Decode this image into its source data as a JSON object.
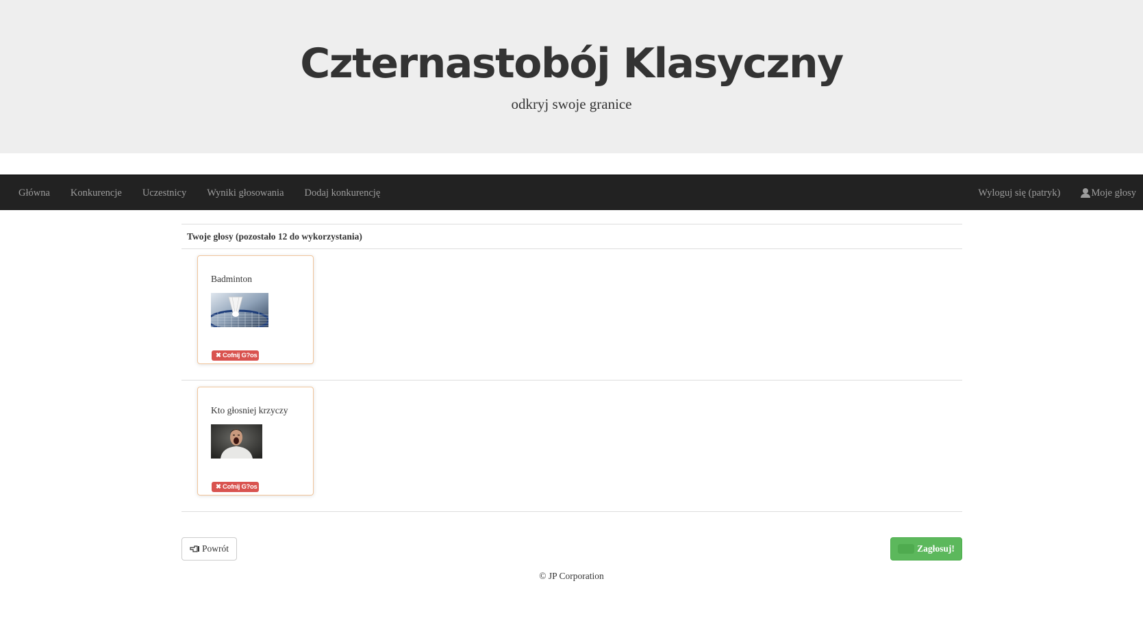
{
  "header": {
    "title": "Czternastobój Klasyczny",
    "subtitle": "odkryj swoje granice"
  },
  "nav": {
    "left": [
      "Główna",
      "Konkurencje",
      "Uczestnicy",
      "Wyniki głosowania",
      "Dodaj konkurencję"
    ],
    "logout": "Wyloguj się (patryk)",
    "my_votes": "Moje głosy"
  },
  "votes": {
    "heading": "Twoje głosy (pozostało 12 do wykorzystania)",
    "items": [
      {
        "name": "Badminton",
        "cancel_label": "Cofnij G?os",
        "image": "badminton-shuttlecock-racket"
      },
      {
        "name": "Kto głosniej krzyczy",
        "cancel_label": "Cofnij G?os",
        "image": "screaming-man"
      }
    ]
  },
  "actions": {
    "back_label": "Powrót",
    "vote_label": "Zagłosuj!"
  },
  "footer": {
    "text": "© JP Corporation"
  },
  "colors": {
    "navbar": "#222222",
    "jumbotron": "#eeeeee",
    "danger": "#d9534f",
    "success": "#5cb85c",
    "card_border": "#f0c49a"
  }
}
